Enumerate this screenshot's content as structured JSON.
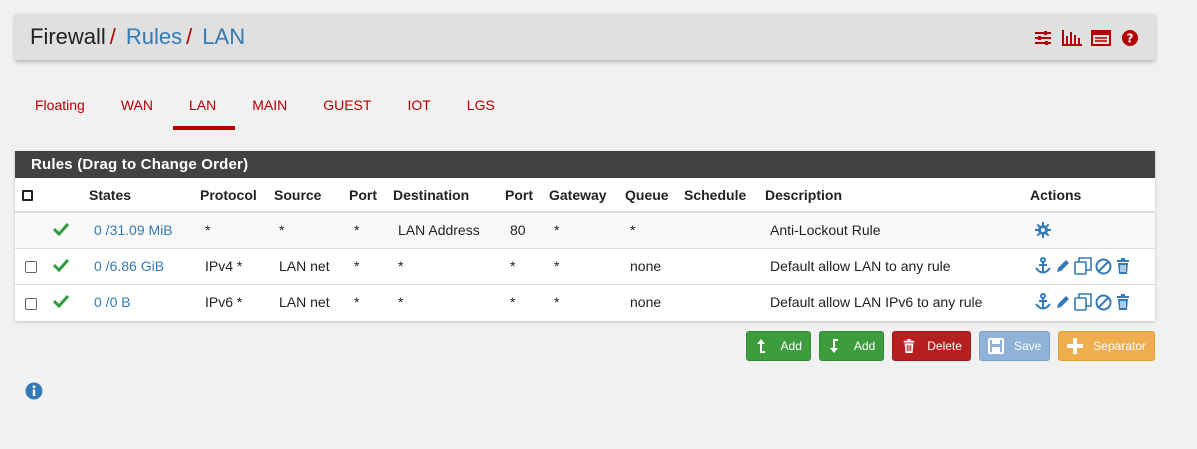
{
  "breadcrumb": {
    "item1": "Firewall",
    "item2": "Rules",
    "item3": "LAN",
    "sep": "/"
  },
  "header_icons": [
    "sliders-icon",
    "bar-chart-icon",
    "table-list-icon",
    "help-icon"
  ],
  "tabs": [
    {
      "label": "Floating"
    },
    {
      "label": "WAN"
    },
    {
      "label": "LAN"
    },
    {
      "label": "MAIN"
    },
    {
      "label": "GUEST"
    },
    {
      "label": "IOT"
    },
    {
      "label": "LGS"
    }
  ],
  "active_tab": "LAN",
  "panel": {
    "title": "Rules (Drag to Change Order)"
  },
  "table": {
    "headers": [
      "States",
      "Protocol",
      "Source",
      "Port",
      "Destination",
      "Port",
      "Gateway",
      "Queue",
      "Schedule",
      "Description",
      "Actions"
    ],
    "rows": [
      {
        "states": "0 /31.09 MiB",
        "protocol": "*",
        "source": "*",
        "port": "*",
        "destination": "LAN Address",
        "dport": "80",
        "gateway": "*",
        "queue": "*",
        "schedule": "",
        "description": "Anti-Lockout Rule"
      },
      {
        "states": "0 /6.86 GiB",
        "protocol": "IPv4 *",
        "source": "LAN net",
        "port": "*",
        "destination": "*",
        "dport": "*",
        "gateway": "*",
        "queue": "none",
        "schedule": "",
        "description": "Default allow LAN to any rule"
      },
      {
        "states": "0 /0 B",
        "protocol": "IPv6 *",
        "source": "LAN net",
        "port": "*",
        "destination": "*",
        "dport": "*",
        "gateway": "*",
        "queue": "none",
        "schedule": "",
        "description": "Default allow LAN IPv6 to any rule"
      }
    ]
  },
  "buttons": {
    "add_top": "Add",
    "add_bottom": "Add",
    "delete": "Delete",
    "save": "Save",
    "separator": "Separator"
  },
  "colors": {
    "accent_red": "#b30000",
    "link_blue": "#337ab7",
    "panel_heading": "#424242",
    "success_green": "#3d9d3d",
    "danger_red": "#b51f1f",
    "save_blue": "#8fb3d6",
    "warning_orange": "#efad4d"
  }
}
